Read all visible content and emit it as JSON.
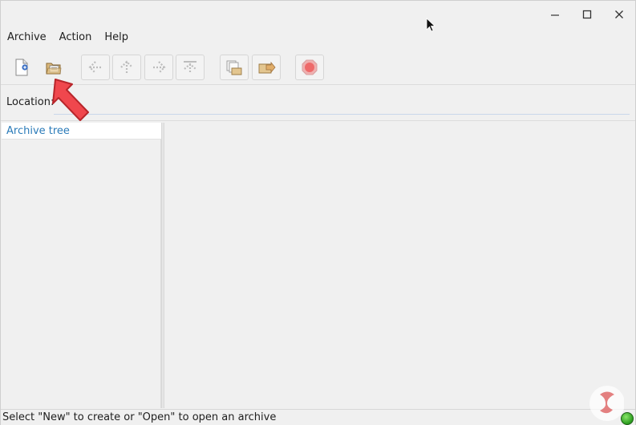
{
  "window": {
    "controls": {
      "minimize_icon": "minimize-icon",
      "maximize_icon": "maximize-icon",
      "close_icon": "close-icon"
    }
  },
  "menubar": {
    "items": [
      {
        "label": "Archive"
      },
      {
        "label": "Action"
      },
      {
        "label": "Help"
      }
    ]
  },
  "toolbar": {
    "buttons": [
      {
        "icon": "new-archive-icon",
        "enabled": true
      },
      {
        "icon": "open-archive-icon",
        "enabled": true
      },
      {
        "icon": "back-icon",
        "enabled": false
      },
      {
        "icon": "up-icon",
        "enabled": false
      },
      {
        "icon": "forward-icon",
        "enabled": false
      },
      {
        "icon": "home-icon",
        "enabled": false
      },
      {
        "icon": "extract-icon",
        "enabled": false
      },
      {
        "icon": "add-files-icon",
        "enabled": false
      },
      {
        "icon": "stop-icon",
        "enabled": false
      }
    ]
  },
  "location": {
    "label": "Location:",
    "value": ""
  },
  "tree": {
    "header": "Archive tree"
  },
  "status": {
    "text": "Select \"New\" to create or \"Open\" to open an archive"
  },
  "colors": {
    "accent": "#2b7bb9",
    "annotation_arrow": "#f0474d",
    "status_ok": "#2a9b1d"
  }
}
